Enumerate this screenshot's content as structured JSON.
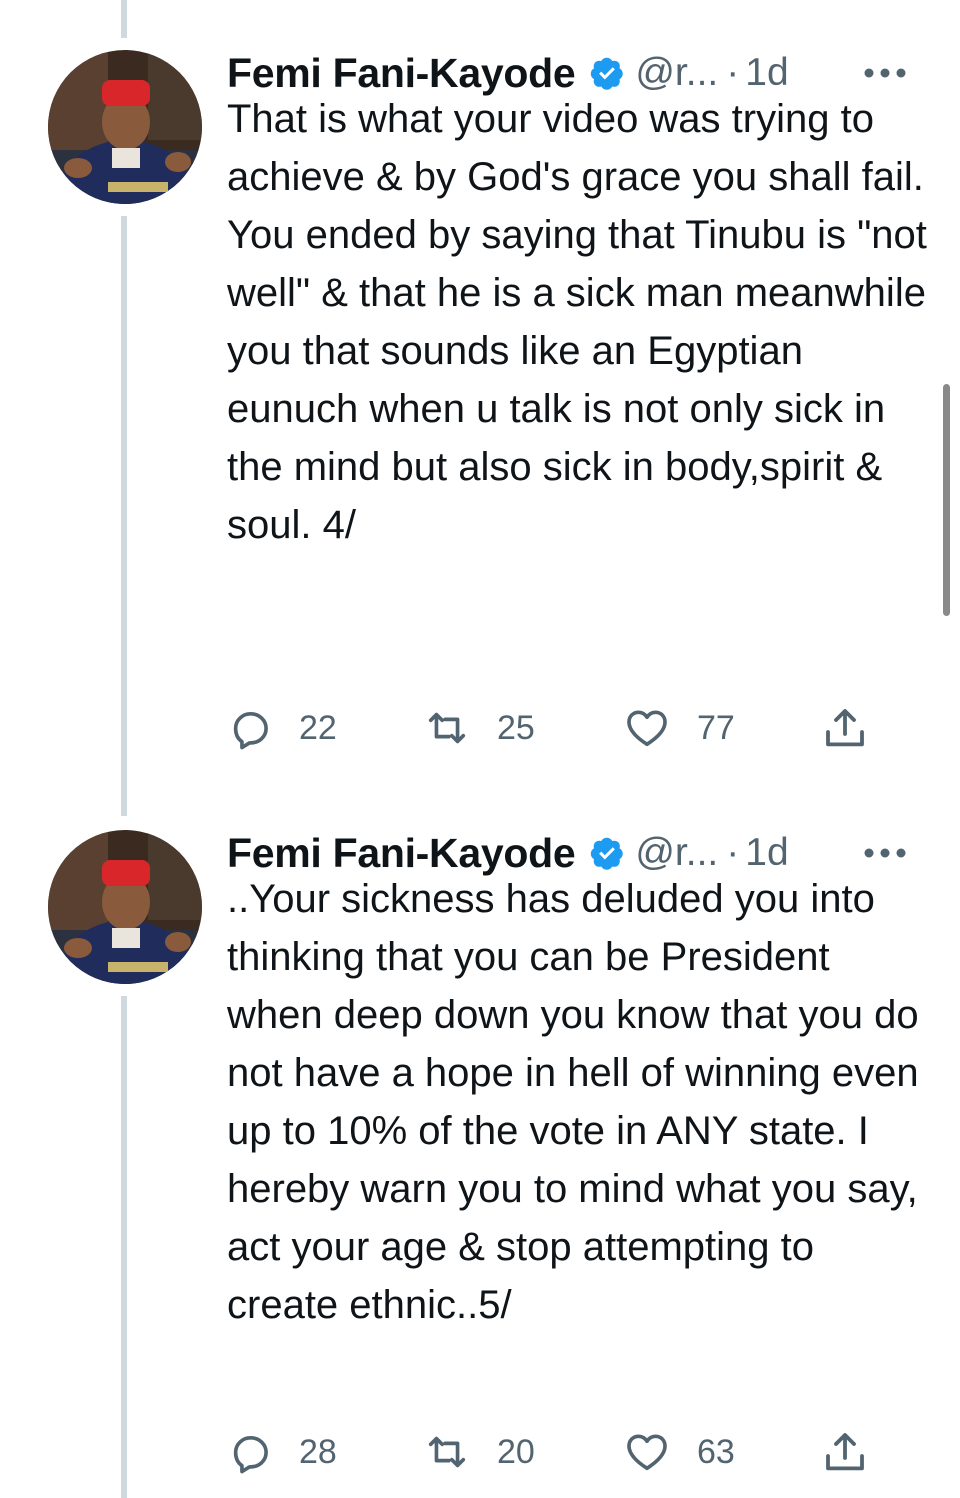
{
  "tweets": [
    {
      "author": {
        "name": "Femi Fani-Kayode",
        "handle": "@r...",
        "verified_icon": "verified-badge-icon"
      },
      "separator": "·",
      "time": "1d",
      "text": "That is what your video was trying to achieve & by God's grace you shall fail.\nYou ended by saying that Tinubu is \"not well\" & that he is a sick man meanwhile you that sounds like an Egyptian eunuch when u talk is not only sick in the mind but also sick in body,spirit & soul. 4/",
      "replies": "22",
      "retweets": "25",
      "likes": "77"
    },
    {
      "author": {
        "name": "Femi Fani-Kayode",
        "handle": "@r...",
        "verified_icon": "verified-badge-icon"
      },
      "separator": "·",
      "time": "1d",
      "text": "..Your sickness has deluded you into thinking that you can be President when deep down you know that you do not have a hope in hell of winning even up to 10% of the vote in ANY state. I hereby warn you to mind what you say, act your age & stop attempting to create ethnic..5/",
      "replies": "28",
      "retweets": "20",
      "likes": "63"
    }
  ],
  "colors": {
    "text": "#0f1419",
    "secondary": "#536471",
    "verified": "#1d9bf0",
    "thread_line": "#cfd9de"
  }
}
